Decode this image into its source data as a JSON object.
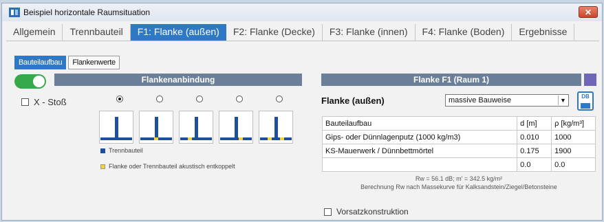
{
  "window": {
    "title": "Beispiel horizontale Raumsituation",
    "close_label": "✕"
  },
  "tabs": [
    {
      "label": "Allgemein"
    },
    {
      "label": "Trennbauteil"
    },
    {
      "label": "F1: Flanke (außen)"
    },
    {
      "label": "F2: Flanke (Decke)"
    },
    {
      "label": "F3: Flanke (innen)"
    },
    {
      "label": "F4: Flanke (Boden)"
    },
    {
      "label": "Ergebnisse"
    }
  ],
  "subtabs": [
    {
      "label": "Bauteilaufbau"
    },
    {
      "label": "Flankenwerte"
    }
  ],
  "left": {
    "band_title": "Flankenanbindung",
    "x_stoss_label": "X - Stoß",
    "legend_trennbauteil": "Trennbauteil",
    "legend_entkoppelt": "Flanke oder Trennbauteil akustisch entkoppelt"
  },
  "right": {
    "band_title": "Flanke F1  (Raum 1)",
    "flanke_label": "Flanke (außen)",
    "select_value": "massive Bauweise",
    "db_label": "DB",
    "table": {
      "headers": [
        "Bauteilaufbau",
        "d [m]",
        "ρ [kg/m³]"
      ],
      "rows": [
        [
          "Gips- oder Dünnlagenputz (1000 kg/m3)",
          "0.010",
          "1000"
        ],
        [
          "KS-Mauerwerk / Dünnbettmörtel",
          "0.175",
          "1900"
        ],
        [
          "",
          "0.0",
          "0.0"
        ]
      ]
    },
    "result_line1": "Rw = 56.1 dB;  m' = 342.5 kg/m²",
    "result_line2": "Berechnung Rw nach Massekurve für Kalksandstein/Ziegel/Betonsteine",
    "vorsatz_label": "Vorsatzkonstruktion"
  },
  "colors": {
    "accent": "#2f78c4",
    "band": "#6b7f98",
    "toggle_on": "#36a94a",
    "wall": "#1f4f9a",
    "decoupled": "#f0d23a"
  }
}
